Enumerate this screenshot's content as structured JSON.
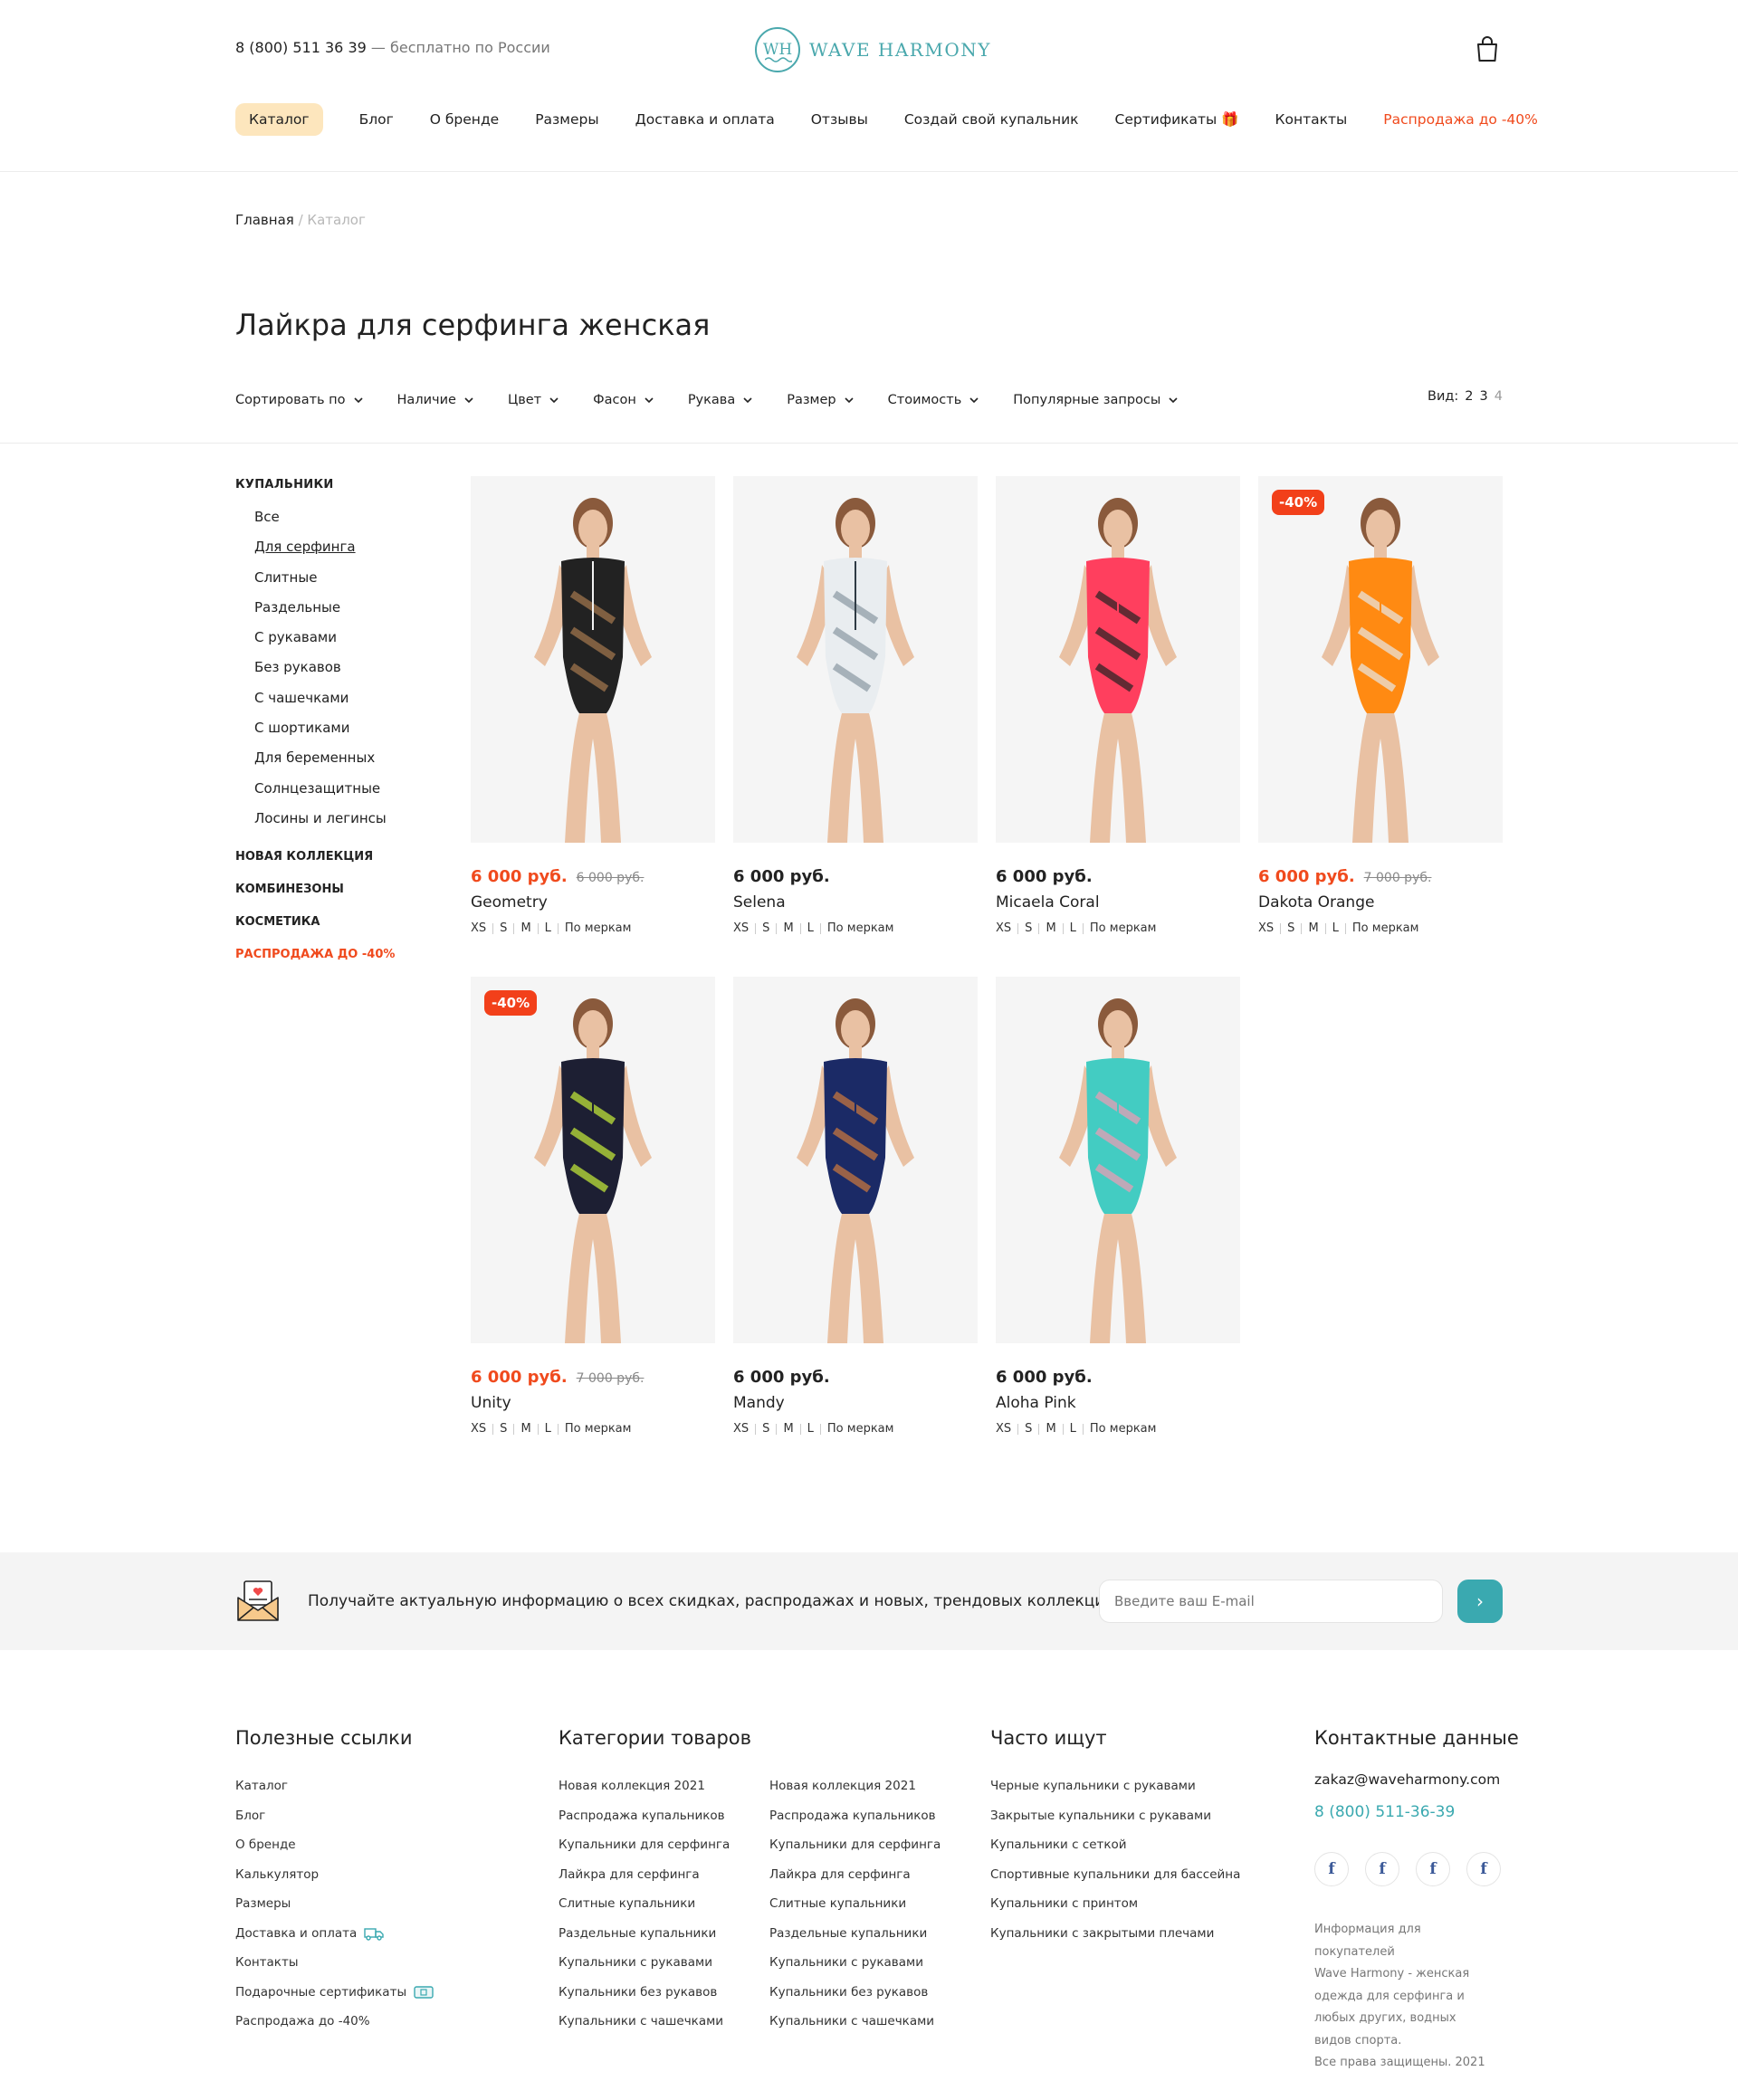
{
  "header": {
    "phone_number": "8 (800) 511 36 39",
    "phone_note": "— бесплатно по России",
    "logo_mark": "WH",
    "logo_text": "WAVE HARMONY"
  },
  "nav": [
    "Каталог",
    "Блог",
    "О бренде",
    "Размеры",
    "Доставка и оплата",
    "Отзывы",
    "Создай свой купальник",
    "Сертификаты 🎁",
    "Контакты",
    "Распродажа до -40%"
  ],
  "breadcrumb": {
    "home": "Главная",
    "sep": "/",
    "current": "Каталог"
  },
  "page_title": "Лайкра для серфинга женская",
  "filters": [
    "Сортировать по",
    "Наличие",
    "Цвет",
    "Фасон",
    "Рукава",
    "Размер",
    "Стоимость",
    "Популярные запросы"
  ],
  "view": {
    "label": "Вид:",
    "options": [
      "2",
      "3",
      "4"
    ]
  },
  "sidebar": {
    "heading": "КУПАЛЬНИКИ",
    "items": [
      "Все",
      "Для серфинга",
      "Слитные",
      "Раздельные",
      "С рукавами",
      "Без рукавов",
      "С чашечками",
      "С шортиками",
      "Для беременных",
      "Солнцезащитные",
      "Лосины и легинсы"
    ],
    "sections": [
      "НОВАЯ КОЛЛЕКЦИЯ",
      "КОМБИНЕЗОНЫ",
      "КОСМЕТИКА",
      "РАСПРОДАЖА ДО -40%"
    ]
  },
  "sizes": [
    "XS",
    "S",
    "M",
    "L",
    "По меркам"
  ],
  "products": [
    {
      "name": "Geometry",
      "price": "6 000 руб.",
      "old_price": "6 000 руб.",
      "badge": "",
      "sale": true,
      "colors": [
        "#222",
        "#f2f2f2",
        "#a77a4f"
      ]
    },
    {
      "name": "Selena",
      "price": "6 000 руб.",
      "old_price": "",
      "badge": "",
      "sale": false,
      "colors": [
        "#e9edf0",
        "#2f3b45",
        "#8a98a3"
      ]
    },
    {
      "name": "Micaela Coral",
      "price": "6 000 руб.",
      "old_price": "",
      "badge": "",
      "sale": false,
      "colors": [
        "#ff3f5e",
        "#ff3f5e",
        "#222"
      ]
    },
    {
      "name": "Dakota Orange",
      "price": "6 000 руб.",
      "old_price": "7 000 руб.",
      "badge": "-40%",
      "sale": true,
      "colors": [
        "#ff8a12",
        "#ff8a12",
        "#e8e8e8"
      ]
    },
    {
      "name": "Unity",
      "price": "6 000 руб.",
      "old_price": "7 000 руб.",
      "badge": "-40%",
      "sale": true,
      "colors": [
        "#1d1f33",
        "#1d1f33",
        "#c9f03a"
      ]
    },
    {
      "name": "Mandy",
      "price": "6 000 руб.",
      "old_price": "",
      "badge": "",
      "sale": false,
      "colors": [
        "#1b2a66",
        "#1b2a66",
        "#d07a3c"
      ]
    },
    {
      "name": "Aloha Pink",
      "price": "6 000 руб.",
      "old_price": "",
      "badge": "",
      "sale": false,
      "colors": [
        "#43ccc2",
        "#43ccc2",
        "#f29bb5"
      ]
    }
  ],
  "newsletter": {
    "text": "Получайте актуальную информацию о всех скидках, распродажах и новых, трендовых коллекциях",
    "placeholder": "Введите ваш E-mail",
    "button": "›"
  },
  "footer": {
    "useful": {
      "title": "Полезные ссылки",
      "links": [
        "Каталог",
        "Блог",
        "О бренде",
        "Калькулятор",
        "Размеры",
        "Доставка и оплата",
        "Контакты",
        "Подарочные сертификаты",
        "Распродажа до -40%"
      ]
    },
    "categories": {
      "title": "Категории товаров",
      "col1": [
        "Новая коллекция 2021",
        "Распродажа купальников",
        "Купальники для серфинга",
        "Лайкра для серфинга",
        "Слитные купальники",
        "Раздельные купальники",
        "Купальники с рукавами",
        "Купальники без рукавов",
        "Купальники с чашечками"
      ],
      "col2": [
        "Новая коллекция 2021",
        "Распродажа купальников",
        "Купальники для серфинга",
        "Лайкра для серфинга",
        "Слитные купальники",
        "Раздельные купальники",
        "Купальники с рукавами",
        "Купальники без рукавов",
        "Купальники с чашечками"
      ]
    },
    "popular": {
      "title": "Часто ищут",
      "links": [
        "Черные купальники с рукавами",
        "Закрытые купальники с рукавами",
        "Купальники с сеткой",
        "Спортивные купальники для бассейна",
        "Купальники с принтом",
        "Купальники с закрытыми плечами"
      ]
    },
    "contacts": {
      "title": "Контактные данные",
      "email": "zakaz@waveharmony.com",
      "phone": "8 (800) 511-36-39",
      "social": [
        "f",
        "f",
        "f",
        "f"
      ],
      "info1": "Информация для покупателей",
      "info2": "Wave Harmony - женская одежда для серфинга и любых других, водных видов спорта.",
      "info3": "Все права защищены. 2021"
    }
  },
  "colors": {
    "accent": "#3aa9b0",
    "sale": "#f04a1d",
    "active_nav": "#fde6bd"
  }
}
